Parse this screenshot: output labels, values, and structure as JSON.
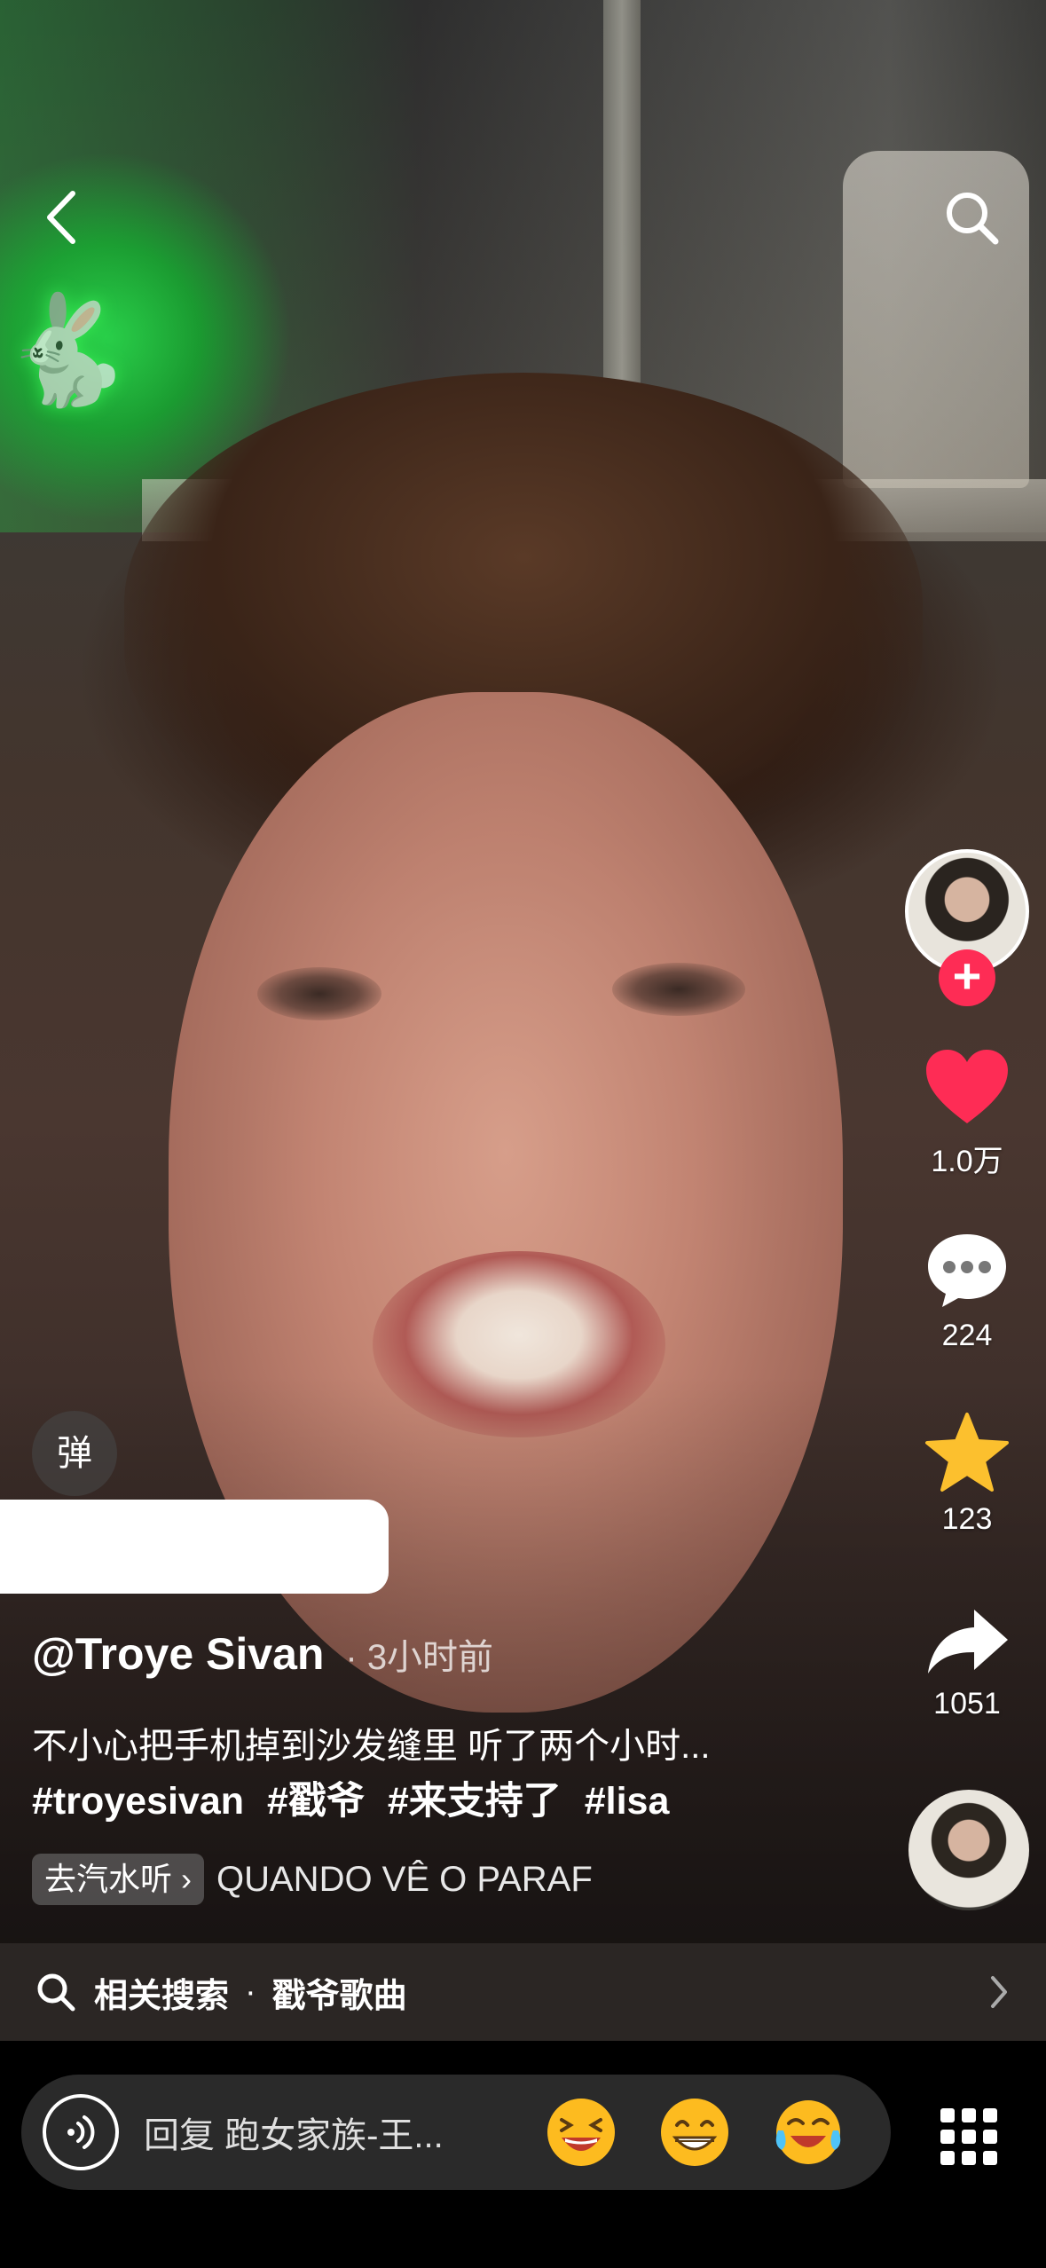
{
  "top_bar": {
    "back_icon": "chevron-left-icon",
    "search_icon": "search-icon"
  },
  "video": {
    "neon_sign": "🐇"
  },
  "right_rail": {
    "follow_symbol": "+",
    "like_count": "1.0万",
    "comment_count": "224",
    "favorite_count": "123",
    "share_count": "1051"
  },
  "danmu": {
    "label": "弹"
  },
  "caption": {
    "author": "@Troye Sivan",
    "separator": "·",
    "time": "3小时前",
    "description": "不小心把手机掉到沙发缝里 听了两个小时...",
    "hashtags": [
      "#troyesivan",
      "#戳爷",
      "#来支持了",
      "#lisa"
    ]
  },
  "music": {
    "chip_label": "去汽水听 ›",
    "title": "QUANDO VÊ O PARAF"
  },
  "related_search": {
    "label": "相关搜索",
    "dot": "·",
    "query": "戳爷歌曲"
  },
  "comment_bar": {
    "placeholder": "回复 跑女家族-王...",
    "emojis": [
      "😆",
      "😁",
      "😂"
    ]
  },
  "colors": {
    "like_red": "#fe2c55",
    "favorite_yellow": "#fcc02e",
    "follow_pink": "#fe2c55",
    "related_bar_bg": "#2b2624"
  }
}
